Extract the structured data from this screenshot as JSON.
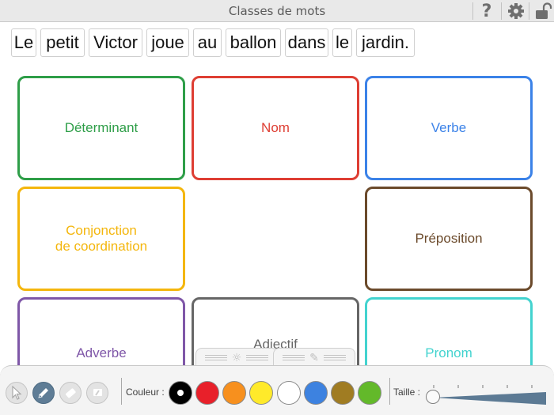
{
  "window": {
    "title": "Classes de mots",
    "help_label": "?"
  },
  "sentence": {
    "words": [
      "Le",
      "petit",
      "Victor",
      "joue",
      "au",
      "ballon",
      "dans",
      "le",
      "jardin."
    ]
  },
  "categories": [
    {
      "label": "Déterminant",
      "color": "#2e9e48"
    },
    {
      "label": "Nom",
      "color": "#de3e33"
    },
    {
      "label": "Verbe",
      "color": "#3b82e8"
    },
    {
      "label": "Conjonction\nde coordination",
      "color": "#f4b60c"
    },
    {
      "label": "Préposition",
      "color": "#6b4a2b"
    },
    {
      "label": "Adverbe",
      "color": "#7f57a8"
    },
    {
      "label": "Adjectif",
      "color": "#666666"
    },
    {
      "label": "Pronom",
      "color": "#43d3cf"
    }
  ],
  "toolbar": {
    "tools": [
      "cursor-icon",
      "pencil-icon",
      "eraser-icon",
      "clear-icon"
    ],
    "active_tool": "pencil-icon",
    "color_label": "Couleur :",
    "colors": [
      "#000000",
      "#e8202a",
      "#f7901e",
      "#ffea2a",
      "#ffffff",
      "#3d82e0",
      "#a07c22",
      "#63b92a"
    ],
    "selected_color": "#000000",
    "size_label": "Taille :",
    "size_value": 0
  }
}
